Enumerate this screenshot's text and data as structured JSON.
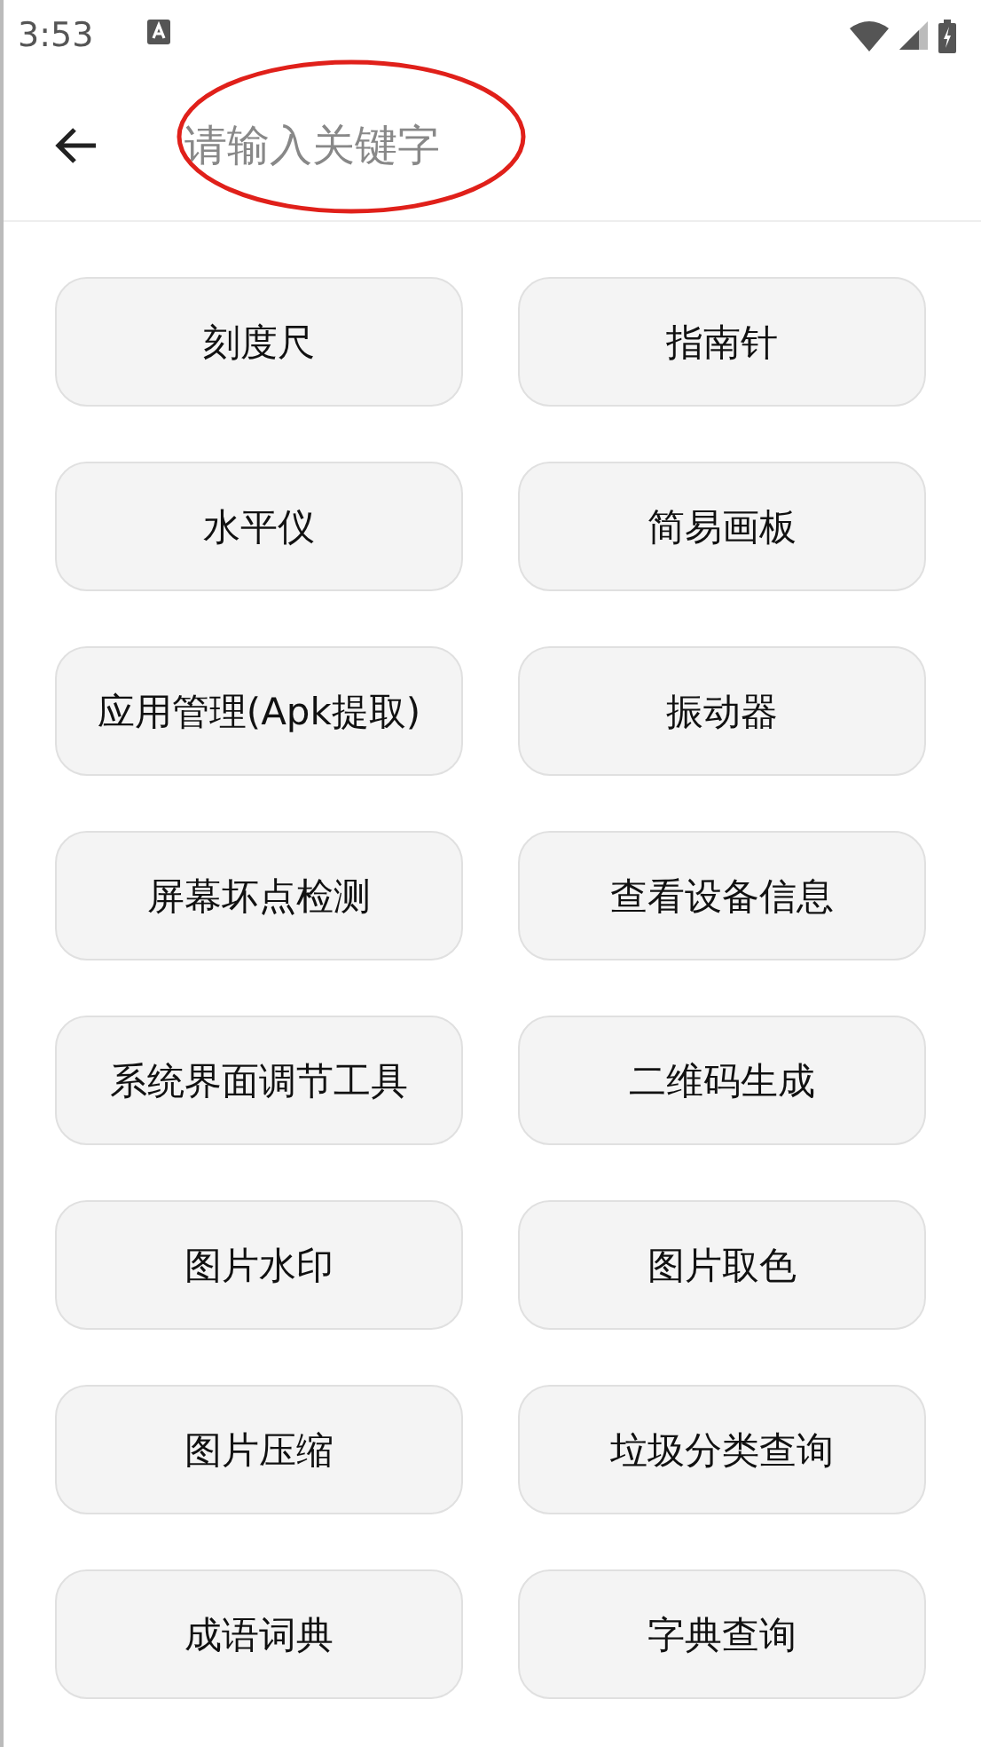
{
  "status_bar": {
    "time": "3:53"
  },
  "search": {
    "placeholder": "请输入关键字"
  },
  "tools": [
    {
      "label": "刻度尺"
    },
    {
      "label": "指南针"
    },
    {
      "label": "水平仪"
    },
    {
      "label": "简易画板"
    },
    {
      "label": "应用管理(Apk提取)"
    },
    {
      "label": "振动器"
    },
    {
      "label": "屏幕坏点检测"
    },
    {
      "label": "查看设备信息"
    },
    {
      "label": "系统界面调节工具"
    },
    {
      "label": "二维码生成"
    },
    {
      "label": "图片水印"
    },
    {
      "label": "图片取色"
    },
    {
      "label": "图片压缩"
    },
    {
      "label": "垃圾分类查询"
    },
    {
      "label": "成语词典"
    },
    {
      "label": "字典查询"
    }
  ]
}
